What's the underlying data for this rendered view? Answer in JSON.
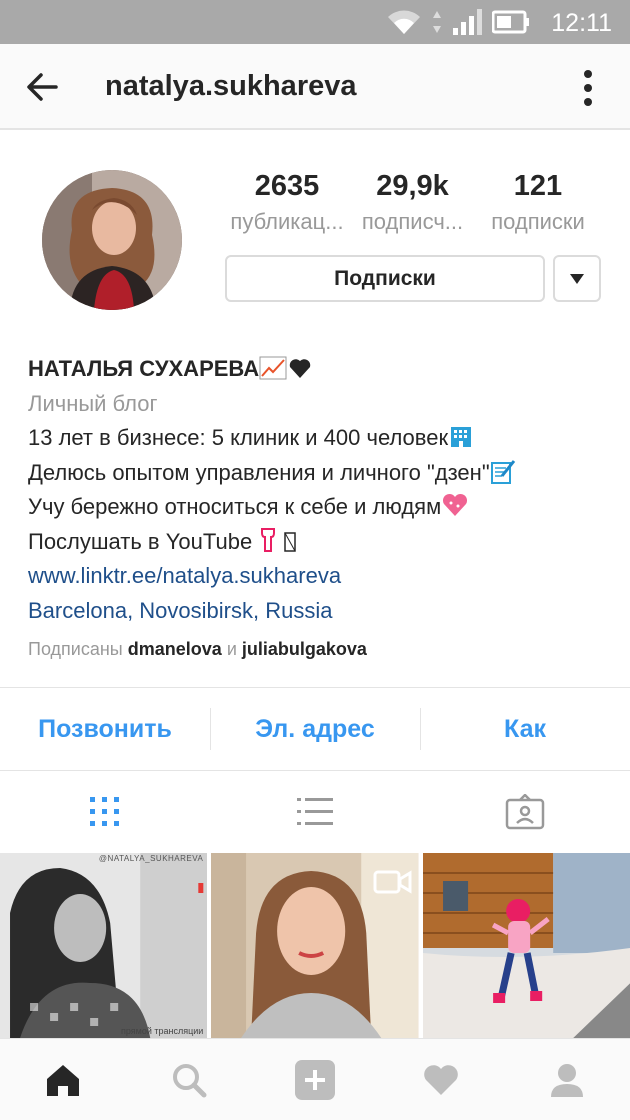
{
  "status_bar": {
    "time": "12:11"
  },
  "header": {
    "username": "natalya.sukhareva"
  },
  "stats": [
    {
      "value": "2635",
      "label": "публикац..."
    },
    {
      "value": "29,9k",
      "label": "подписч..."
    },
    {
      "value": "121",
      "label": "подписки"
    }
  ],
  "follow_button": {
    "label": "Подписки"
  },
  "bio": {
    "name": "НАТАЛЬЯ СУХАРЕВА",
    "category": "Личный блог",
    "lines": [
      "13 лет в бизнесе: 5 клиник и 400 человек",
      "Делюсь опытом управления и личного \"дзен\"",
      "Учу бережно относиться к себе и людям",
      "Послушать в YouTube"
    ],
    "link": "www.linktr.ee/natalya.sukhareva",
    "location": "Barcelona, Novosibirsk, Russia",
    "followed_by": {
      "prefix": "Подписаны",
      "user1": "dmanelova",
      "conj": "и",
      "user2": "juliabulgakova"
    }
  },
  "action_buttons": [
    "Позвонить",
    "Эл. адрес",
    "Как"
  ],
  "posts": [
    {
      "watermark": "@NATALYA_SUKHAREVA",
      "caption": "прямой трансляции"
    },
    {
      "type": "video"
    },
    {
      "type": "photo"
    }
  ],
  "colors": {
    "accent": "#3897f0",
    "link": "#1f4f8a",
    "muted": "#999999",
    "text": "#262626"
  }
}
